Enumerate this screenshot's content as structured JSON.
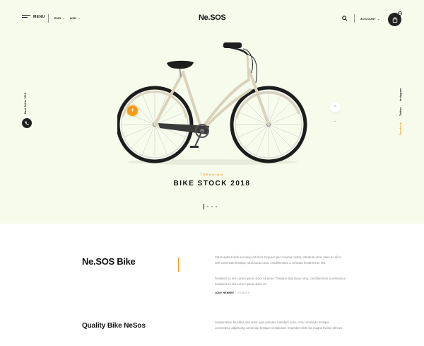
{
  "header": {
    "menu_label": "MENU",
    "language": "ENG",
    "currency": "USD",
    "logo": "Ne.SOS",
    "account_label": "ACCOUNT",
    "cart_count": "0"
  },
  "side": {
    "left_text": "Best Seller 2018",
    "social": [
      "Instagram",
      "Twitter",
      "Facebook"
    ],
    "active_social": "Facebook"
  },
  "hero": {
    "eyebrow": "TRENDING",
    "title": "BIKE STOCK 2018",
    "slides_total": 4,
    "slide_active": 1
  },
  "about": {
    "brand": "Ne.SOS Bike",
    "paragraph1": "Class aptent taciti sociosqu ad litora torquent per conubia nostra, interdum urna. Nam ac elit a velit commodo tristique. Duis lacus urna, condimentum a vehicula hendrerit ac nisl.",
    "paragraph2": "hendrerit ac nisi Lorem ipsum dolor sit amet. Tristique duis lacus urna, condimentum a vehicula a hendrerit ac nisi Lorem ipsum dolor sit",
    "author_name": "JONY HENRRY",
    "author_role": "/ FOUNDER"
  },
  "quality": {
    "heading": "Quality Bike NeSos",
    "paragraph": "Suspendisse faucibus sed dolor eget posuere interdum urna, urna commodo tristique consectetur adipiscing commodo tristique vestibulum. Imperdiet nibh nisl magna lacinia ultrices."
  },
  "colors": {
    "accent": "#f59a17",
    "hero_bg": "#f6fbec",
    "dark": "#222222"
  },
  "icons": [
    "hamburger-icon",
    "chevron-down-icon",
    "search-icon",
    "shopping-bag-icon",
    "phone-icon",
    "plus-icon",
    "chevron-up-icon",
    "chevron-down-icon"
  ]
}
